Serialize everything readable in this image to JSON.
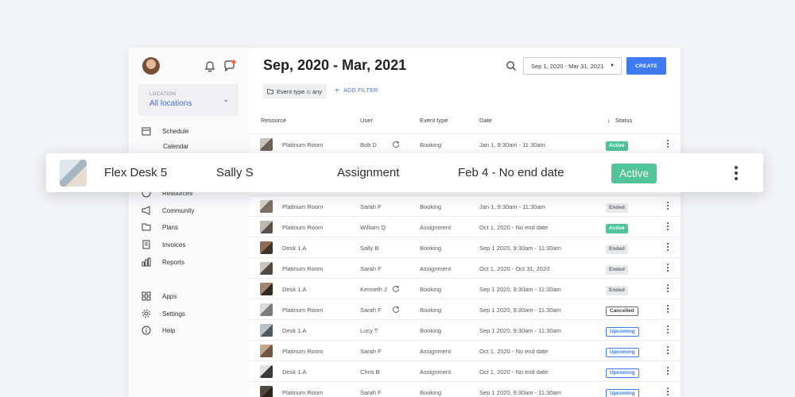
{
  "sidebar": {
    "location_label": "LOCATION",
    "location_value": "All locations",
    "nav": [
      {
        "label": "Schedule",
        "icon": "calendar-icon"
      },
      {
        "label": "Calendar"
      },
      {
        "label": "Resources",
        "icon": "globe-icon"
      },
      {
        "label": "Community",
        "icon": "megaphone-icon"
      },
      {
        "label": "Plans",
        "icon": "folder-icon"
      },
      {
        "label": "Invoices",
        "icon": "invoice-icon"
      },
      {
        "label": "Reports",
        "icon": "bar-chart-icon"
      },
      {
        "label": "Apps",
        "icon": "apps-icon"
      },
      {
        "label": "Settings",
        "icon": "gear-icon"
      },
      {
        "label": "Help",
        "icon": "info-icon"
      }
    ]
  },
  "header": {
    "title": "Sep, 2020 - Mar, 2021",
    "date_range": "Sep 1, 2020 - Mar 31, 2021",
    "create_label": "CREATE"
  },
  "filter": {
    "field": "Event type",
    "op": "is",
    "value": "any",
    "add_label": "ADD FILTER"
  },
  "table": {
    "columns": [
      "Resource",
      "User",
      "Event type",
      "Date",
      "Status"
    ],
    "sort_indicator": "↓",
    "rows": [
      {
        "resource": "Platinum Room",
        "user": "Bob D",
        "event": "Booking",
        "date": "Jan 1, 9:30am - 11:30am",
        "status": "Active",
        "recurring": true
      },
      {
        "resource": "Platinum Room",
        "user": "Sarah F",
        "event": "Booking",
        "date": "Jan 1, 9:30am - 11:30am",
        "status": "Ended",
        "recurring": false
      },
      {
        "resource": "Platinum Room",
        "user": "William Q",
        "event": "Assignment",
        "date": "Oct 1, 2020 - No end date",
        "status": "Active",
        "recurring": false
      },
      {
        "resource": "Desk 1.A",
        "user": "Sally B",
        "event": "Booking",
        "date": "Sep 1 2020, 9:30am - 11:30am",
        "status": "Ended",
        "recurring": false
      },
      {
        "resource": "Platinum Room",
        "user": "Sarah F",
        "event": "Assignment",
        "date": "Oct 1, 2020 - Oct 31, 2020",
        "status": "Ended",
        "recurring": false
      },
      {
        "resource": "Desk 1.A",
        "user": "Kenneth J",
        "event": "Booking",
        "date": "Sep 1 2020, 9:30am - 11:30am",
        "status": "Ended",
        "recurring": true
      },
      {
        "resource": "Platinum Room",
        "user": "Sarah F",
        "event": "Booking",
        "date": "Sep 1 2020, 9:30am - 11:30am",
        "status": "Cancelled",
        "recurring": true
      },
      {
        "resource": "Desk 1.A",
        "user": "Lucy T",
        "event": "Booking",
        "date": "Sep 1 2020, 9:30am - 11:30am",
        "status": "Upcoming",
        "recurring": false
      },
      {
        "resource": "Platinum Room",
        "user": "Sarah F",
        "event": "Assignment",
        "date": "Oct 1, 2020 - No end date",
        "status": "Upcoming",
        "recurring": false
      },
      {
        "resource": "Desk 1.A",
        "user": "Chris B",
        "event": "Assignment",
        "date": "Oct 1, 2020 - No end date",
        "status": "Upcoming",
        "recurring": false
      },
      {
        "resource": "Platinum Room",
        "user": "Sarah F",
        "event": "Booking",
        "date": "Sep 1 2020, 9:30am - 11:30am",
        "status": "Upcoming",
        "recurring": false
      }
    ]
  },
  "highlight": {
    "resource": "Flex Desk 5",
    "user": "Sally S",
    "event": "Assignment",
    "date": "Feb 4 - No end date",
    "status": "Active"
  },
  "colors": {
    "accent": "#3e7bf2",
    "active": "#52c49a",
    "link": "#3e6fe2",
    "notification_dot": "#f2673a"
  }
}
